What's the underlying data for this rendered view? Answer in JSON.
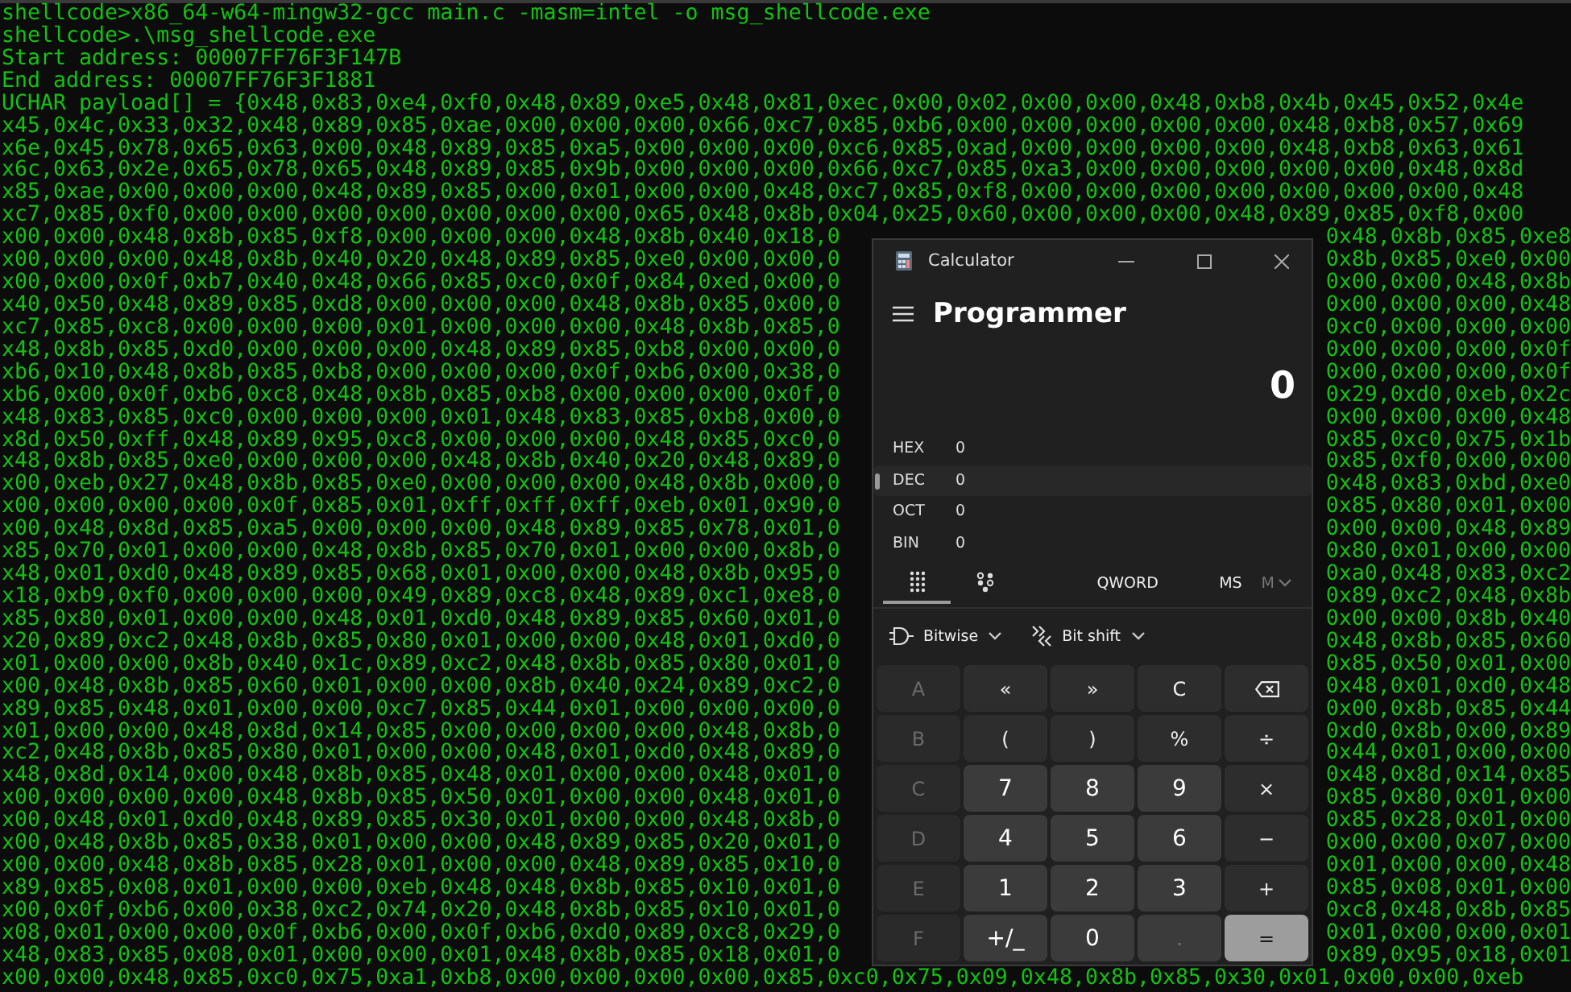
{
  "terminal": {
    "lines": [
      {
        "kind": "full",
        "text": "shellcode>x86_64-w64-mingw32-gcc main.c -masm=intel -o msg_shellcode.exe"
      },
      {
        "kind": "full",
        "text": "shellcode>.\\msg_shellcode.exe"
      },
      {
        "kind": "full",
        "text": "Start address: 00007FF76F3F147B"
      },
      {
        "kind": "full",
        "text": "End address: 00007FF76F3F1881"
      },
      {
        "kind": "full",
        "text": "UCHAR payload[] = {0x48,0x83,0xe4,0xf0,0x48,0x89,0xe5,0x48,0x81,0xec,0x00,0x02,0x00,0x00,0x48,0xb8,0x4b,0x45,0x52,0x4e"
      },
      {
        "kind": "full",
        "text": "x45,0x4c,0x33,0x32,0x48,0x89,0x85,0xae,0x00,0x00,0x00,0x66,0xc7,0x85,0xb6,0x00,0x00,0x00,0x00,0x00,0x48,0xb8,0x57,0x69"
      },
      {
        "kind": "full",
        "text": "x6e,0x45,0x78,0x65,0x63,0x00,0x48,0x89,0x85,0xa5,0x00,0x00,0x00,0xc6,0x85,0xad,0x00,0x00,0x00,0x00,0x48,0xb8,0x63,0x61"
      },
      {
        "kind": "full",
        "text": "x6c,0x63,0x2e,0x65,0x78,0x65,0x48,0x89,0x85,0x9b,0x00,0x00,0x00,0x66,0xc7,0x85,0xa3,0x00,0x00,0x00,0x00,0x00,0x48,0x8d"
      },
      {
        "kind": "full",
        "text": "x85,0xae,0x00,0x00,0x00,0x48,0x89,0x85,0x00,0x01,0x00,0x00,0x48,0xc7,0x85,0xf8,0x00,0x00,0x00,0x00,0x00,0x00,0x00,0x48"
      },
      {
        "kind": "full",
        "text": "xc7,0x85,0xf0,0x00,0x00,0x00,0x00,0x00,0x00,0x00,0x65,0x48,0x8b,0x04,0x25,0x60,0x00,0x00,0x00,0x48,0x89,0x85,0xf8,0x00"
      },
      {
        "kind": "split",
        "left": "x00,0x00,0x48,0x8b,0x85,0xf8,0x00,0x00,0x00,0x48,0x8b,0x40,0x18,0",
        "right": "0x48,0x8b,0x85,0xe8"
      },
      {
        "kind": "split",
        "left": "x00,0x00,0x00,0x48,0x8b,0x40,0x20,0x48,0x89,0x85,0xe0,0x00,0x00,0",
        "right": "0x8b,0x85,0xe0,0x00"
      },
      {
        "kind": "split",
        "left": "x00,0x00,0x0f,0xb7,0x40,0x48,0x66,0x85,0xc0,0x0f,0x84,0xed,0x00,0",
        "right": "0x00,0x00,0x48,0x8b"
      },
      {
        "kind": "split",
        "left": "x40,0x50,0x48,0x89,0x85,0xd8,0x00,0x00,0x00,0x48,0x8b,0x85,0x00,0",
        "right": "0x00,0x00,0x00,0x48"
      },
      {
        "kind": "split",
        "left": "xc7,0x85,0xc8,0x00,0x00,0x00,0x01,0x00,0x00,0x00,0x48,0x8b,0x85,0",
        "right": "0xc0,0x00,0x00,0x00"
      },
      {
        "kind": "split",
        "left": "x48,0x8b,0x85,0xd0,0x00,0x00,0x00,0x48,0x89,0x85,0xb8,0x00,0x00,0",
        "right": "0x00,0x00,0x00,0x0f"
      },
      {
        "kind": "split",
        "left": "xb6,0x10,0x48,0x8b,0x85,0xb8,0x00,0x00,0x00,0x0f,0xb6,0x00,0x38,0",
        "right": "0x00,0x00,0x00,0x0f"
      },
      {
        "kind": "split",
        "left": "xb6,0x00,0x0f,0xb6,0xc8,0x48,0x8b,0x85,0xb8,0x00,0x00,0x00,0x0f,0",
        "right": "0x29,0xd0,0xeb,0x2c"
      },
      {
        "kind": "split",
        "left": "x48,0x83,0x85,0xc0,0x00,0x00,0x00,0x01,0x48,0x83,0x85,0xb8,0x00,0",
        "right": "0x00,0x00,0x00,0x48"
      },
      {
        "kind": "split",
        "left": "x8d,0x50,0xff,0x48,0x89,0x95,0xc8,0x00,0x00,0x00,0x48,0x85,0xc0,0",
        "right": "0x85,0xc0,0x75,0x1b"
      },
      {
        "kind": "split",
        "left": "x48,0x8b,0x85,0xe0,0x00,0x00,0x00,0x48,0x8b,0x40,0x20,0x48,0x89,0",
        "right": "0x85,0xf0,0x00,0x00"
      },
      {
        "kind": "split",
        "left": "x00,0xeb,0x27,0x48,0x8b,0x85,0xe0,0x00,0x00,0x00,0x48,0x8b,0x00,0",
        "right": "0x48,0x83,0xbd,0xe0"
      },
      {
        "kind": "split",
        "left": "x00,0x00,0x00,0x00,0x0f,0x85,0x01,0xff,0xff,0xff,0xeb,0x01,0x90,0",
        "right": "0x85,0x80,0x01,0x00"
      },
      {
        "kind": "split",
        "left": "x00,0x48,0x8d,0x85,0xa5,0x00,0x00,0x00,0x48,0x89,0x85,0x78,0x01,0",
        "right": "0x00,0x00,0x48,0x89"
      },
      {
        "kind": "split",
        "left": "x85,0x70,0x01,0x00,0x00,0x48,0x8b,0x85,0x70,0x01,0x00,0x00,0x8b,0",
        "right": "0x80,0x01,0x00,0x00"
      },
      {
        "kind": "split",
        "left": "x48,0x01,0xd0,0x48,0x89,0x85,0x68,0x01,0x00,0x00,0x48,0x8b,0x95,0",
        "right": "0xa0,0x48,0x83,0xc2"
      },
      {
        "kind": "split",
        "left": "x18,0xb9,0xf0,0x00,0x00,0x00,0x49,0x89,0xc8,0x48,0x89,0xc1,0xe8,0",
        "right": "0x89,0xc2,0x48,0x8b"
      },
      {
        "kind": "split",
        "left": "x85,0x80,0x01,0x00,0x00,0x48,0x01,0xd0,0x48,0x89,0x85,0x60,0x01,0",
        "right": "0x00,0x00,0x8b,0x40"
      },
      {
        "kind": "split",
        "left": "x20,0x89,0xc2,0x48,0x8b,0x85,0x80,0x01,0x00,0x00,0x48,0x01,0xd0,0",
        "right": "0x48,0x8b,0x85,0x60"
      },
      {
        "kind": "split",
        "left": "x01,0x00,0x00,0x8b,0x40,0x1c,0x89,0xc2,0x48,0x8b,0x85,0x80,0x01,0",
        "right": "0x85,0x50,0x01,0x00"
      },
      {
        "kind": "split",
        "left": "x00,0x48,0x8b,0x85,0x60,0x01,0x00,0x00,0x8b,0x40,0x24,0x89,0xc2,0",
        "right": "0x48,0x01,0xd0,0x48"
      },
      {
        "kind": "split",
        "left": "x89,0x85,0x48,0x01,0x00,0x00,0xc7,0x85,0x44,0x01,0x00,0x00,0x00,0",
        "right": "0x00,0x8b,0x85,0x44"
      },
      {
        "kind": "split",
        "left": "x01,0x00,0x00,0x48,0x8d,0x14,0x85,0x00,0x00,0x00,0x00,0x48,0x8b,0",
        "right": "0xd0,0x8b,0x00,0x89"
      },
      {
        "kind": "split",
        "left": "xc2,0x48,0x8b,0x85,0x80,0x01,0x00,0x00,0x48,0x01,0xd0,0x48,0x89,0",
        "right": "0x44,0x01,0x00,0x00"
      },
      {
        "kind": "split",
        "left": "x48,0x8d,0x14,0x00,0x48,0x8b,0x85,0x48,0x01,0x00,0x00,0x48,0x01,0",
        "right": "0x48,0x8d,0x14,0x85"
      },
      {
        "kind": "split",
        "left": "x00,0x00,0x00,0x00,0x48,0x8b,0x85,0x50,0x01,0x00,0x00,0x48,0x01,0",
        "right": "0x85,0x80,0x01,0x00"
      },
      {
        "kind": "split",
        "left": "x00,0x48,0x01,0xd0,0x48,0x89,0x85,0x30,0x01,0x00,0x00,0x48,0x8b,0",
        "right": "0x85,0x28,0x01,0x00"
      },
      {
        "kind": "split",
        "left": "x00,0x48,0x8b,0x85,0x38,0x01,0x00,0x00,0x48,0x89,0x85,0x20,0x01,0",
        "right": "0x00,0x00,0x07,0x00"
      },
      {
        "kind": "split",
        "left": "x00,0x00,0x48,0x8b,0x85,0x28,0x01,0x00,0x00,0x48,0x89,0x85,0x10,0",
        "right": "0x01,0x00,0x00,0x48"
      },
      {
        "kind": "split",
        "left": "x89,0x85,0x08,0x01,0x00,0x00,0xeb,0x48,0x48,0x8b,0x85,0x10,0x01,0",
        "right": "0x85,0x08,0x01,0x00"
      },
      {
        "kind": "split",
        "left": "x00,0x0f,0xb6,0x00,0x38,0xc2,0x74,0x20,0x48,0x8b,0x85,0x10,0x01,0",
        "right": "0xc8,0x48,0x8b,0x85"
      },
      {
        "kind": "split",
        "left": "x08,0x01,0x00,0x00,0x0f,0xb6,0x00,0x0f,0xb6,0xd0,0x89,0xc8,0x29,0",
        "right": "0x01,0x00,0x00,0x01"
      },
      {
        "kind": "split",
        "left": "x48,0x83,0x85,0x08,0x01,0x00,0x00,0x01,0x48,0x8b,0x85,0x18,0x01,0",
        "right": "0x89,0x95,0x18,0x01"
      },
      {
        "kind": "full",
        "text": "x00,0x00,0x48,0x85,0xc0,0x75,0xa1,0xb8,0x00,0x00,0x00,0x00,0x85,0xc0,0x75,0x09,0x48,0x8b,0x85,0x30,0x01,0x00,0x00,0xeb"
      }
    ]
  },
  "calculator": {
    "title": "Calculator",
    "mode": "Programmer",
    "display": "0",
    "bases": [
      {
        "label": "HEX",
        "value": "0",
        "selected": false
      },
      {
        "label": "DEC",
        "value": "0",
        "selected": true
      },
      {
        "label": "OCT",
        "value": "0",
        "selected": false
      },
      {
        "label": "BIN",
        "value": "0",
        "selected": false
      }
    ],
    "view_tabs": [
      {
        "kind": "keypad",
        "selected": true
      },
      {
        "kind": "bits",
        "selected": false
      }
    ],
    "word_size": "QWORD",
    "memory": [
      {
        "label": "MS",
        "disabled": false,
        "kind": "plain"
      },
      {
        "label": "M",
        "disabled": true,
        "kind": "menu"
      }
    ],
    "dropdowns": [
      {
        "label": "Bitwise",
        "kind": "bitwise"
      },
      {
        "label": "Bit shift",
        "kind": "shift"
      }
    ],
    "keys": [
      {
        "label": "A",
        "kind": "disabled"
      },
      {
        "label": "«",
        "kind": "op"
      },
      {
        "label": "»",
        "kind": "op"
      },
      {
        "label": "C",
        "kind": "op"
      },
      {
        "kind": "backspace"
      },
      {
        "label": "B",
        "kind": "disabled"
      },
      {
        "label": "(",
        "kind": "op"
      },
      {
        "label": ")",
        "kind": "op"
      },
      {
        "label": "%",
        "kind": "op"
      },
      {
        "label": "÷",
        "kind": "op"
      },
      {
        "label": "C",
        "kind": "disabled"
      },
      {
        "label": "7",
        "kind": "digit"
      },
      {
        "label": "8",
        "kind": "digit"
      },
      {
        "label": "9",
        "kind": "digit"
      },
      {
        "label": "×",
        "kind": "op"
      },
      {
        "label": "D",
        "kind": "disabled"
      },
      {
        "label": "4",
        "kind": "digit"
      },
      {
        "label": "5",
        "kind": "digit"
      },
      {
        "label": "6",
        "kind": "digit"
      },
      {
        "label": "−",
        "kind": "op"
      },
      {
        "label": "E",
        "kind": "disabled"
      },
      {
        "label": "1",
        "kind": "digit"
      },
      {
        "label": "2",
        "kind": "digit"
      },
      {
        "label": "3",
        "kind": "digit"
      },
      {
        "label": "+",
        "kind": "op"
      },
      {
        "label": "F",
        "kind": "disabled"
      },
      {
        "label": "+/_",
        "kind": "digit"
      },
      {
        "label": "0",
        "kind": "digit"
      },
      {
        "label": ".",
        "kind": "disabled-digit"
      },
      {
        "label": "=",
        "kind": "equals"
      }
    ]
  }
}
